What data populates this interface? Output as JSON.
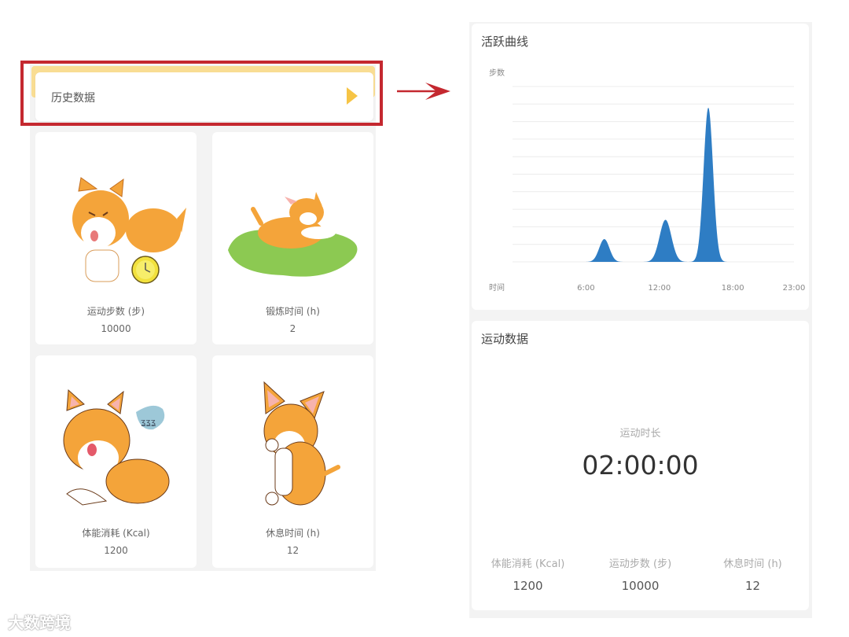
{
  "history": {
    "label": "历史数据"
  },
  "tiles": [
    {
      "label": "运动步数 (步)",
      "value": "10000"
    },
    {
      "label": "锻炼时间 (h)",
      "value": "2"
    },
    {
      "label": "体能消耗 (Kcal)",
      "value": "1200"
    },
    {
      "label": "休息时间 (h)",
      "value": "12"
    }
  ],
  "activity": {
    "title": "活跃曲线",
    "chart_data": {
      "type": "area",
      "ylabel": "步数",
      "xlabel": "时间",
      "xticks": [
        "6:00",
        "12:00",
        "18:00",
        "23:00"
      ],
      "x_range": [
        0,
        23
      ],
      "ylim": [
        0,
        10
      ],
      "grid": true,
      "color": "#2e7dc4",
      "peaks": [
        {
          "x": 7.5,
          "y": 1.3,
          "width": 1.3
        },
        {
          "x": 12.5,
          "y": 2.4,
          "width": 1.5
        },
        {
          "x": 16.0,
          "y": 8.8,
          "width": 1.2
        }
      ]
    }
  },
  "sport": {
    "title": "运动数据",
    "duration_label": "运动时长",
    "duration_value": "02:00:00",
    "stats": [
      {
        "label": "体能消耗 (Kcal)",
        "value": "1200"
      },
      {
        "label": "运动步数 (步)",
        "value": "10000"
      },
      {
        "label": "休息时间 (h)",
        "value": "12"
      }
    ]
  },
  "watermark": "大数跨境",
  "colors": {
    "accent": "#f6c445",
    "highlight": "#c4282f",
    "series": "#2e7dc4"
  }
}
